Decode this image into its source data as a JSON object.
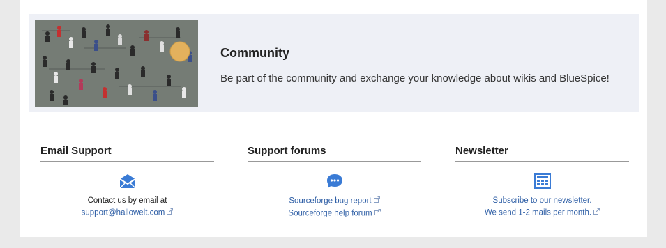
{
  "community": {
    "title": "Community",
    "description": "Be part of the community and exchange your knowledge about wikis and BlueSpice!",
    "image_alt": "crowd-of-people-photo"
  },
  "email_support": {
    "heading": "Email Support",
    "icon": "envelope-icon",
    "text": "Contact us by email at",
    "link": "support@hallowelt.com"
  },
  "support_forums": {
    "heading": "Support forums",
    "icon": "chat-bubble-icon",
    "links": [
      "Sourceforge bug report",
      "Sourceforge help forum"
    ]
  },
  "newsletter": {
    "heading": "Newsletter",
    "icon": "newspaper-icon",
    "lines": [
      "Subscribe to our newsletter.",
      "We send 1-2 mails per month."
    ]
  },
  "colors": {
    "accent": "#3a7bd5",
    "link": "#2f5fa6",
    "panel": "#eef0f6"
  }
}
